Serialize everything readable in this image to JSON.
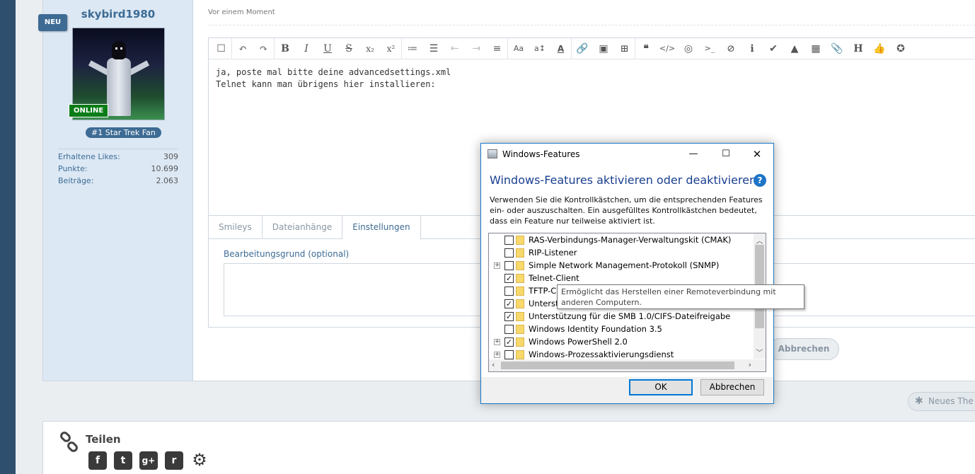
{
  "user": {
    "name": "skybird1980",
    "new_badge": "NEU",
    "online": "ONLINE",
    "rank": "#1 Star Trek Fan",
    "stats": [
      {
        "label": "Erhaltene Likes:",
        "value": "309"
      },
      {
        "label": "Punkte:",
        "value": "10.699"
      },
      {
        "label": "Beiträge:",
        "value": "2.063"
      }
    ]
  },
  "post": {
    "timestamp": "Vor einem Moment"
  },
  "editor": {
    "line1": "ja, poste mal bitte deine advancedsettings.xml",
    "line2": "Telnet kann man übrigens hier installieren:",
    "toolbar": {
      "bold": "B",
      "italic": "I",
      "underline": "U",
      "strike": "S",
      "subscript": "x₂",
      "superscript": "x²",
      "font_size": "Aa",
      "text_size": "a↕",
      "text_color": "A",
      "heading": "H"
    },
    "tabs": [
      "Smileys",
      "Dateianhänge",
      "Einstellungen"
    ],
    "reason_label": "Bearbeitungsgrund (optional)",
    "cancel": "Abbrechen"
  },
  "new_thread": "Neues The",
  "share": {
    "title": "Teilen",
    "facebook": "f",
    "twitter": "t",
    "google": "g+",
    "reddit": "r"
  },
  "dialog": {
    "title": "Windows-Features",
    "heading": "Windows-Features aktivieren oder deaktivieren",
    "help": "?",
    "description": "Verwenden Sie die Kontrollkästchen, um die entsprechenden Features ein- oder auszuschalten. Ein ausgefülltes Kontrollkästchen bedeutet, dass ein Feature nur teilweise aktiviert ist.",
    "features": [
      {
        "label": "RAS-Verbindungs-Manager-Verwaltungskit (CMAK)",
        "checked": false,
        "expandable": false
      },
      {
        "label": "RIP-Listener",
        "checked": false,
        "expandable": false
      },
      {
        "label": "Simple Network Management-Protokoll (SNMP)",
        "checked": false,
        "expandable": true
      },
      {
        "label": "Telnet-Client",
        "checked": true,
        "expandable": false
      },
      {
        "label": "TFTP-C",
        "checked": false,
        "expandable": false
      },
      {
        "label": "Unterst",
        "checked": true,
        "expandable": false
      },
      {
        "label": "Unterstützung für die SMB 1.0/CIFS-Dateifreigabe",
        "checked": true,
        "expandable": false
      },
      {
        "label": "Windows Identity Foundation 3.5",
        "checked": false,
        "expandable": false
      },
      {
        "label": "Windows PowerShell 2.0",
        "checked": true,
        "expandable": true
      },
      {
        "label": "Windows-Prozessaktivierungsdienst",
        "checked": false,
        "expandable": true
      }
    ],
    "tooltip": "Ermöglicht das Herstellen einer Remoteverbindung mit anderen Computern.",
    "ok": "OK",
    "cancel": "Abbrechen"
  }
}
